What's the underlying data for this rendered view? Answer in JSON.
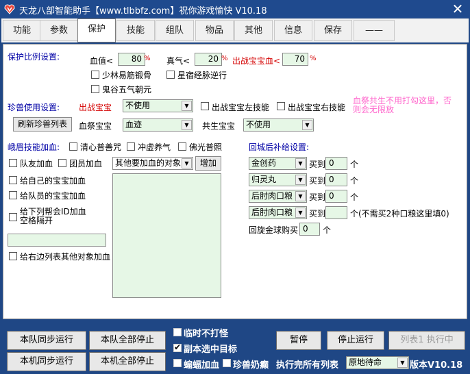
{
  "window": {
    "title": "天龙八部智能助手【www.tlbbfz.com】祝你游戏愉快 V10.18",
    "close_glyph": "✕"
  },
  "tabs": [
    {
      "label": "功能"
    },
    {
      "label": "参数"
    },
    {
      "label": "保护"
    },
    {
      "label": "技能"
    },
    {
      "label": "组队"
    },
    {
      "label": "物品"
    },
    {
      "label": "其他"
    },
    {
      "label": "信息"
    },
    {
      "label": "保存"
    },
    {
      "label": "——"
    }
  ],
  "protect": {
    "heading": "保护比例设置:",
    "hp_label": "血值<",
    "hp_value": "80",
    "mp_label": "真气<",
    "mp_value": "20",
    "pet_label": "出战宝宝血<",
    "pet_value": "70",
    "percent": "%",
    "skills": [
      "少林易筋锻骨",
      "星宿经脉逆行",
      "鬼谷五气朝元"
    ]
  },
  "pets": {
    "heading": "珍兽使用设置:",
    "battle_pet_label": "出战宝宝",
    "battle_pet_value": "不使用",
    "left_skill": "出战宝宝左技能",
    "right_skill": "出战宝宝右技能",
    "note": "血祭共生不用打勾这里，否则会无限放",
    "refresh_button": "刷新珍兽列表",
    "blood_pet_label": "血祭宝宝",
    "blood_pet_value": "血迹",
    "co_pet_label": "共生宝宝",
    "co_pet_value": "不使用"
  },
  "emei": {
    "heading": "峨眉技能加血:",
    "skills": [
      "清心普善咒",
      "冲虚养气",
      "佛光普照"
    ],
    "team_heal": "队友加血",
    "member_heal": "团员加血",
    "other_target_value": "其他要加血的对象",
    "add_button": "增加",
    "self_pet": "给自己的宝宝加血",
    "member_pet": "给队员的宝宝加血",
    "guild_heal": "给下列帮会ID加血\n空格隔开",
    "right_list_heal": "给右边列表其他对象加血"
  },
  "resupply": {
    "heading": "回城后补给设置:",
    "buy_label": "买到",
    "unit": "个",
    "items": [
      {
        "name": "金创药",
        "qty": "0",
        "note": ""
      },
      {
        "name": "归灵丸",
        "qty": "0",
        "note": ""
      },
      {
        "name": "后肘肉口粮",
        "qty": "0",
        "note": ""
      },
      {
        "name": "后肘肉口粮",
        "qty": "",
        "note": "(不需买2种口粮这里填0)"
      }
    ],
    "ball_label": "回旋金球购买",
    "ball_qty": "0"
  },
  "bottom": {
    "team_sync_run": "本队同步运行",
    "team_all_stop": "本队全部停止",
    "local_sync_run": "本机同步运行",
    "local_all_stop": "本机全部停止",
    "temp_no_hit": "临时不打怪",
    "instance_target": "副本选中目标",
    "bat_heal": "蝙蝠加血",
    "pet_milk": "珍兽奶癫",
    "pause": "暂停",
    "stop_run": "停止运行",
    "list_running": "列表1 执行中",
    "after_all_label": "执行完所有列表",
    "after_all_value": "原地待命",
    "version": "版本V10.18"
  }
}
